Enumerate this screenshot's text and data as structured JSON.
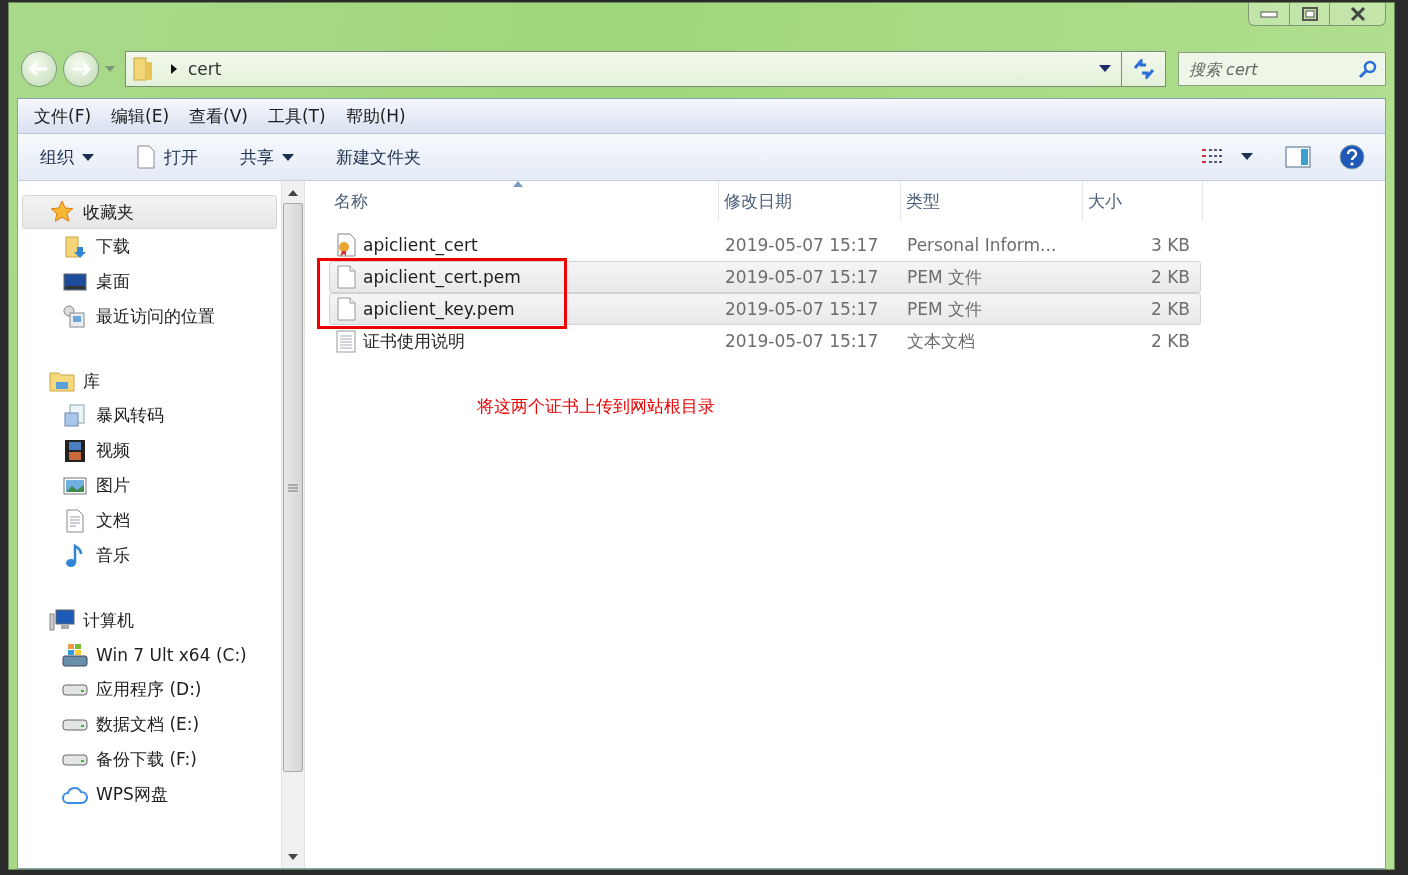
{
  "address": {
    "path": "cert"
  },
  "search": {
    "placeholder": "搜索 cert"
  },
  "menu": [
    "文件(F)",
    "编辑(E)",
    "查看(V)",
    "工具(T)",
    "帮助(H)"
  ],
  "toolbar": [
    {
      "label": "组织",
      "kind": "dropdown"
    },
    {
      "label": "打开",
      "kind": "file"
    },
    {
      "label": "共享",
      "kind": "dropdown"
    },
    {
      "label": "新建文件夹",
      "kind": "plain"
    }
  ],
  "sidebar": {
    "groups": [
      {
        "label": "收藏夹",
        "kind": "star",
        "selected": true,
        "children": [
          {
            "label": "下载",
            "kind": "download"
          },
          {
            "label": "桌面",
            "kind": "desktop"
          },
          {
            "label": "最近访问的位置",
            "kind": "recent"
          }
        ]
      },
      {
        "label": "库",
        "kind": "library",
        "selected": false,
        "children": [
          {
            "label": "暴风转码",
            "kind": "converter"
          },
          {
            "label": "视频",
            "kind": "video"
          },
          {
            "label": "图片",
            "kind": "picture"
          },
          {
            "label": "文档",
            "kind": "document"
          },
          {
            "label": "音乐",
            "kind": "music"
          }
        ]
      },
      {
        "label": "计算机",
        "kind": "computer",
        "selected": false,
        "children": [
          {
            "label": "Win 7 Ult x64 (C:)",
            "kind": "windrive"
          },
          {
            "label": "应用程序 (D:)",
            "kind": "drive"
          },
          {
            "label": "数据文档 (E:)",
            "kind": "drive"
          },
          {
            "label": "备份下载 (F:)",
            "kind": "drive"
          },
          {
            "label": "WPS网盘",
            "kind": "cloud"
          }
        ]
      }
    ]
  },
  "table": {
    "columns": [
      "名称",
      "修改日期",
      "类型",
      "大小"
    ],
    "rows": [
      {
        "name": "apiclient_cert",
        "date": "2019-05-07 15:17",
        "type": "Personal Inform...",
        "size": "3 KB",
        "kind": "cert",
        "selected": false
      },
      {
        "name": "apiclient_cert.pem",
        "date": "2019-05-07 15:17",
        "type": "PEM 文件",
        "size": "2 KB",
        "kind": "file",
        "selected": true
      },
      {
        "name": "apiclient_key.pem",
        "date": "2019-05-07 15:17",
        "type": "PEM 文件",
        "size": "2 KB",
        "kind": "file",
        "selected": true
      },
      {
        "name": "证书使用说明",
        "date": "2019-05-07 15:17",
        "type": "文本文档",
        "size": "2 KB",
        "kind": "text",
        "selected": false
      }
    ]
  },
  "annotation": {
    "note": "将这两个证书上传到网站根目录"
  }
}
